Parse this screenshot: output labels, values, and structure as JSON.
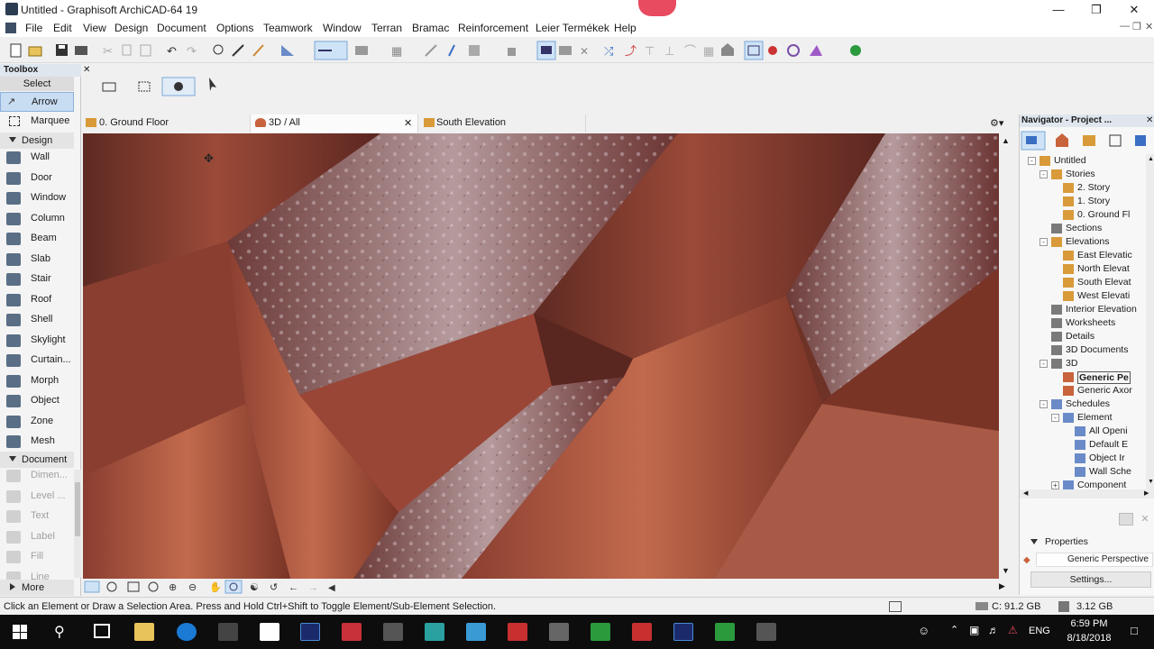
{
  "window": {
    "title": "Untitled - Graphisoft ArchiCAD-64 19"
  },
  "menu": [
    "File",
    "Edit",
    "View",
    "Design",
    "Document",
    "Options",
    "Teamwork",
    "Window",
    "Terran",
    "Bramac",
    "Reinforcement",
    "Leier Termékek",
    "Help"
  ],
  "toolbox": {
    "title": "Toolbox",
    "select_header": "Select",
    "select_tools": [
      {
        "label": "Arrow",
        "icon": "arrow-icon"
      },
      {
        "label": "Marquee",
        "icon": "marquee-icon"
      }
    ],
    "design_header": "Design",
    "design_tools": [
      {
        "label": "Wall",
        "icon": "wall-icon"
      },
      {
        "label": "Door",
        "icon": "door-icon"
      },
      {
        "label": "Window",
        "icon": "window-icon"
      },
      {
        "label": "Column",
        "icon": "column-icon"
      },
      {
        "label": "Beam",
        "icon": "beam-icon"
      },
      {
        "label": "Slab",
        "icon": "slab-icon"
      },
      {
        "label": "Stair",
        "icon": "stair-icon"
      },
      {
        "label": "Roof",
        "icon": "roof-icon"
      },
      {
        "label": "Shell",
        "icon": "shell-icon"
      },
      {
        "label": "Skylight",
        "icon": "skylight-icon"
      },
      {
        "label": "Curtain...",
        "icon": "curtain-wall-icon"
      },
      {
        "label": "Morph",
        "icon": "morph-icon"
      },
      {
        "label": "Object",
        "icon": "object-icon"
      },
      {
        "label": "Zone",
        "icon": "zone-icon"
      },
      {
        "label": "Mesh",
        "icon": "mesh-icon"
      }
    ],
    "document_header": "Document",
    "document_tools": [
      {
        "label": "Dimen...",
        "icon": "dimension-icon"
      },
      {
        "label": "Level ...",
        "icon": "level-icon"
      },
      {
        "label": "Text",
        "icon": "text-icon"
      },
      {
        "label": "Label",
        "icon": "label-icon"
      },
      {
        "label": "Fill",
        "icon": "fill-icon"
      },
      {
        "label": "Line",
        "icon": "line-icon"
      }
    ],
    "more_label": "More"
  },
  "tabs": [
    {
      "label": "0. Ground Floor",
      "icon": "floor-plan-icon"
    },
    {
      "label": "3D / All",
      "icon": "3d-view-icon",
      "active": true
    },
    {
      "label": "South Elevation",
      "icon": "elevation-icon"
    }
  ],
  "navigator": {
    "title": "Navigator - Project ...",
    "tree": [
      {
        "label": "Untitled",
        "level": 0,
        "toggle": "-",
        "icon": "project-icon"
      },
      {
        "label": "Stories",
        "level": 1,
        "toggle": "-",
        "icon": "folder-icon"
      },
      {
        "label": "2. Story",
        "level": 2,
        "icon": "story-icon"
      },
      {
        "label": "1. Story",
        "level": 2,
        "icon": "story-icon"
      },
      {
        "label": "0. Ground Fl",
        "level": 2,
        "icon": "story-icon"
      },
      {
        "label": "Sections",
        "level": 1,
        "icon": "sections-icon"
      },
      {
        "label": "Elevations",
        "level": 1,
        "toggle": "-",
        "icon": "elevations-icon"
      },
      {
        "label": "East Elevatic",
        "level": 2,
        "icon": "elevation-icon"
      },
      {
        "label": "North Elevat",
        "level": 2,
        "icon": "elevation-icon"
      },
      {
        "label": "South Elevat",
        "level": 2,
        "icon": "elevation-icon"
      },
      {
        "label": "West Elevati",
        "level": 2,
        "icon": "elevation-icon"
      },
      {
        "label": "Interior Elevation",
        "level": 1,
        "icon": "interior-elevation-icon"
      },
      {
        "label": "Worksheets",
        "level": 1,
        "icon": "worksheets-icon"
      },
      {
        "label": "Details",
        "level": 1,
        "icon": "details-icon"
      },
      {
        "label": "3D Documents",
        "level": 1,
        "icon": "3d-documents-icon"
      },
      {
        "label": "3D",
        "level": 1,
        "toggle": "-",
        "icon": "3d-icon"
      },
      {
        "label": "Generic Pe",
        "level": 2,
        "icon": "perspective-icon",
        "selected": true
      },
      {
        "label": "Generic Axor",
        "level": 2,
        "icon": "axonometry-icon"
      },
      {
        "label": "Schedules",
        "level": 1,
        "toggle": "-",
        "icon": "schedules-icon"
      },
      {
        "label": "Element",
        "level": 2,
        "toggle": "-",
        "icon": "element-icon"
      },
      {
        "label": "All Openi",
        "level": 3,
        "icon": "schedule-icon"
      },
      {
        "label": "Default E",
        "level": 3,
        "icon": "schedule-icon"
      },
      {
        "label": "Object Ir",
        "level": 3,
        "icon": "schedule-icon"
      },
      {
        "label": "Wall Sche",
        "level": 3,
        "icon": "schedule-icon"
      },
      {
        "label": "Component",
        "level": 2,
        "toggle": "+",
        "icon": "component-icon"
      }
    ],
    "properties_label": "Properties",
    "property_value": "Generic Perspective",
    "settings_label": "Settings..."
  },
  "status": {
    "message": "Click an Element or Draw a Selection Area. Press and Hold Ctrl+Shift to Toggle Element/Sub-Element Selection.",
    "disk": "C: 91.2 GB",
    "memory": "3.12 GB"
  },
  "taskbar": {
    "lang": "ENG",
    "time": "6:59 PM",
    "date": "8/18/2018"
  },
  "colors": {
    "accent": "#0078d7",
    "tile_dark": "#5e2a22",
    "tile_mid": "#8e3f31",
    "tile_light": "#b65d45"
  }
}
